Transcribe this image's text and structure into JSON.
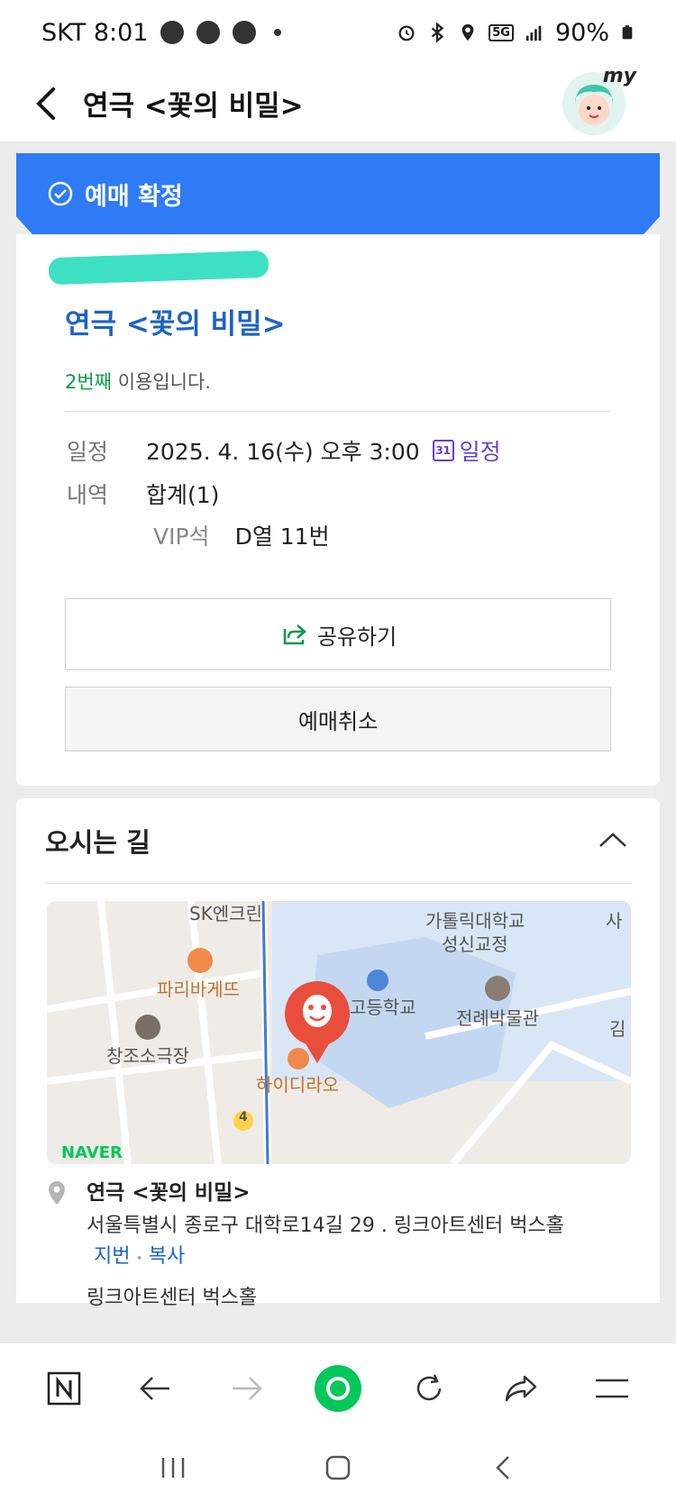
{
  "status_bar": {
    "carrier_time": "SKT 8:01",
    "battery": "90%",
    "network": "5G"
  },
  "header": {
    "title": "연극 <꽃의 비밀>",
    "avatar_label": "my"
  },
  "booking": {
    "status": "예매 확정",
    "show_title": "연극 <꽃의 비밀>",
    "use_count_highlight": "2번째",
    "use_count_rest": " 이용입니다.",
    "schedule_label": "일정",
    "schedule_value": "2025. 4. 16(수) 오후 3:00",
    "schedule_link": "일정",
    "calendar_day": "31",
    "detail_label": "내역",
    "detail_value": "합계(1)",
    "seat_grade": "VIP석",
    "seat_value": "D열 11번",
    "share_label": "공유하기",
    "cancel_label": "예매취소"
  },
  "directions": {
    "title": "오시는 길",
    "map_labels": {
      "sk": "SK엔크린",
      "catholic": "가톨릭대학교",
      "campus": "성신교정",
      "paris": "파리바게뜨",
      "school": "고등학교",
      "museum": "전례박물관",
      "theater": "창조소극장",
      "hydrao": "하이디라오",
      "route": "4",
      "side1": "사",
      "side2": "김"
    },
    "map_brand": "NAVER",
    "venue_name": "연극 <꽃의 비밀>",
    "venue_address": "서울특별시 종로구 대학로14길 29 . 링크아트센터 벅스홀",
    "lot_link": "지번",
    "copy_link": "복사",
    "venue_hall": "링크아트센터 벅스홀"
  },
  "colors": {
    "accent": "#2f7bf5",
    "title_blue": "#1b63c4",
    "green": "#0a9a4a",
    "purple": "#6c3fc9",
    "naver_green": "#03c75a"
  }
}
